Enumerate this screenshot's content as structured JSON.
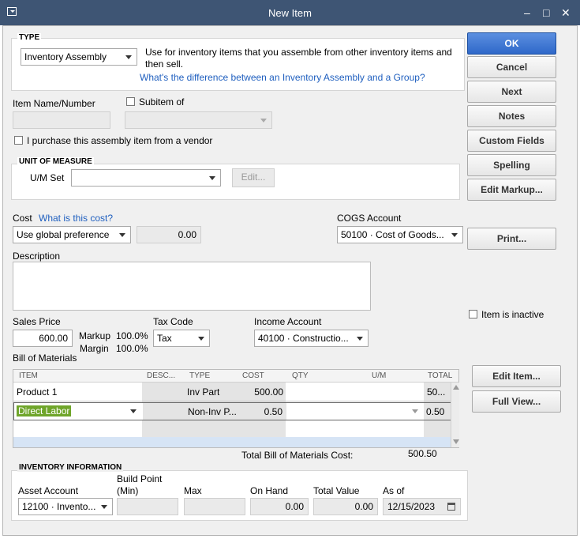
{
  "window": {
    "title": "New Item"
  },
  "type": {
    "label": "TYPE",
    "selected": "Inventory Assembly",
    "description": "Use for inventory items that you assemble from other inventory items and then sell.",
    "link": "What's the difference between an Inventory Assembly and a Group?"
  },
  "item": {
    "name_label": "Item Name/Number",
    "subitem_label": "Subitem of",
    "vendor_label": "I purchase this assembly item from a vendor"
  },
  "uom": {
    "section": "UNIT OF MEASURE",
    "label": "U/M Set",
    "edit_button": "Edit..."
  },
  "cost": {
    "label": "Cost",
    "link": "What is this cost?",
    "method": "Use global preference",
    "value": "0.00",
    "cogs_label": "COGS Account",
    "cogs_value": "50100 · Cost of Goods..."
  },
  "description": {
    "label": "Description"
  },
  "sales": {
    "price_label": "Sales Price",
    "price": "600.00",
    "markup_label": "Markup",
    "markup": "100.0%",
    "margin_label": "Margin",
    "margin": "100.0%",
    "tax_label": "Tax Code",
    "tax": "Tax",
    "income_label": "Income Account",
    "income": "40100 · Constructio..."
  },
  "bom": {
    "label": "Bill of Materials",
    "columns": [
      "ITEM",
      "DESC...",
      "TYPE",
      "COST",
      "QTY",
      "U/M",
      "TOTAL"
    ],
    "rows": [
      {
        "item": "Product 1",
        "type": "Inv Part",
        "cost": "500.00",
        "total": "50..."
      },
      {
        "item": "Direct Labor",
        "type": "Non-Inv P...",
        "cost": "0.50",
        "total": "0.50"
      }
    ],
    "total_label": "Total Bill of Materials Cost:",
    "total": "500.50"
  },
  "inventory": {
    "section": "INVENTORY INFORMATION",
    "asset_label": "Asset Account",
    "asset": "12100 · Invento...",
    "build_label1": "Build Point",
    "build_label2": "(Min)",
    "max_label": "Max",
    "onhand_label": "On Hand",
    "onhand": "0.00",
    "total_label": "Total Value",
    "total": "0.00",
    "asof_label": "As of",
    "asof": "12/15/2023"
  },
  "buttons": {
    "ok": "OK",
    "cancel": "Cancel",
    "next": "Next",
    "notes": "Notes",
    "custom": "Custom Fields",
    "spelling": "Spelling",
    "markup": "Edit Markup...",
    "print": "Print...",
    "edit_item": "Edit Item...",
    "full_view": "Full View..."
  },
  "inactive_label": "Item is inactive"
}
